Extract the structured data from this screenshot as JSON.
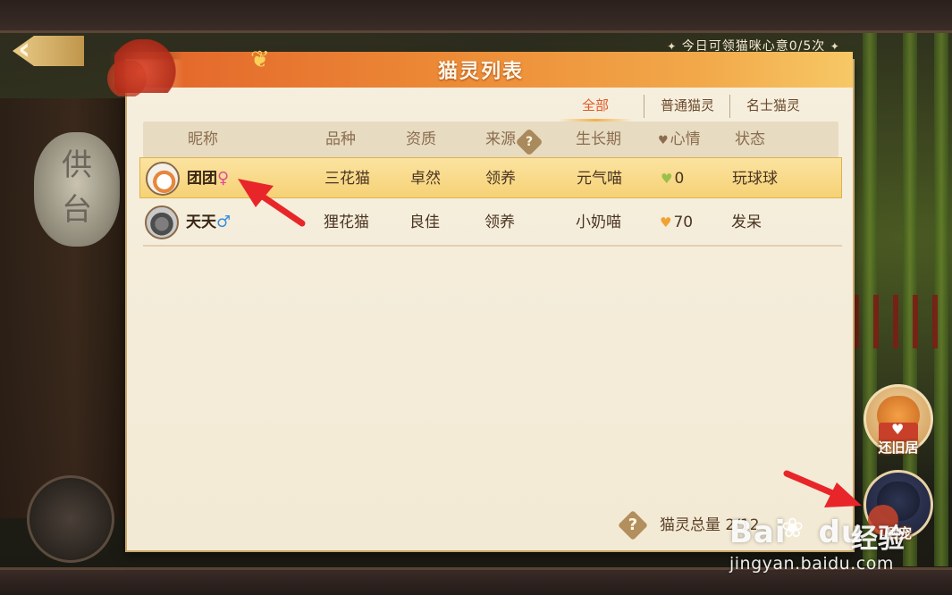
{
  "notice": "今日可领猫咪心意0/5次",
  "panel": {
    "title": "猫灵列表"
  },
  "tabs": [
    {
      "label": "全部",
      "active": true
    },
    {
      "label": "普通猫灵",
      "active": false
    },
    {
      "label": "名士猫灵",
      "active": false
    }
  ],
  "columns": {
    "nickname": "昵称",
    "breed": "品种",
    "quality": "资质",
    "source": "来源",
    "growth": "生长期",
    "mood": "心情",
    "status": "状态"
  },
  "cats": [
    {
      "name": "团团",
      "sex": "♀",
      "breed": "三花猫",
      "quality": "卓然",
      "source": "领养",
      "growth": "元气喵",
      "mood": "0",
      "status": "玩球球",
      "selected": true
    },
    {
      "name": "天天",
      "sex": "♂",
      "breed": "狸花猫",
      "quality": "良佳",
      "source": "领养",
      "growth": "小奶喵",
      "mood": "70",
      "status": "发呆",
      "selected": false
    }
  ],
  "footer": {
    "total_label": "猫灵总量",
    "total_value": "2/12"
  },
  "side_buttons": {
    "home_label": "还旧居",
    "share_label": "晒宠"
  },
  "watermark": {
    "brand": "Bai",
    "brand_suffix": "du",
    "cn": "经验",
    "url": "jingyan.baidu.com"
  },
  "colors": {
    "accent": "#e05a28",
    "title_bar": "#ec8a36",
    "selected_row": "#f6d276",
    "arrow": "#e8262a"
  }
}
